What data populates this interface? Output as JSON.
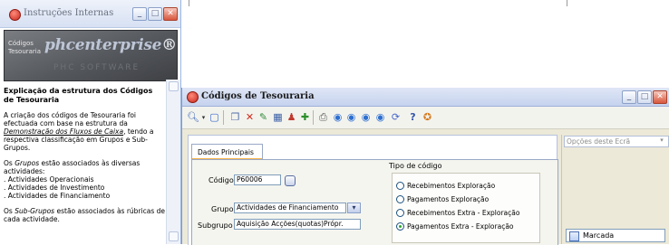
{
  "help_window": {
    "title": "Instruções Internas",
    "banner": {
      "label_line1": "Códigos",
      "label_line2": "Tesouraria",
      "logo_text": "phcenterprise",
      "watermark": "PHC SOFTWARE"
    },
    "content": {
      "heading": "Explicação da estrutura dos Códigos de Tesouraria",
      "p1_before": "A criação dos códigos de Tesouraria foi efectuada com base na estrutura da ",
      "p1_link": "Demonstração dos Fluxos de Caixa",
      "p1_after": ", tendo a respectiva classificação em Grupos e Sub-Grupos.",
      "p2_italic": "Grupos",
      "p2_rest": " estão associados às diversas actividades:",
      "list": [
        ". Actividades Operacionais",
        ". Actividades de Investimento",
        ". Actividades de Financiamento"
      ],
      "p3_before": "Os ",
      "p3_italic": "Sub-Grupos",
      "p3_after": " estão associados às rúbricas de cada actividade.",
      "p2_prefix": "Os "
    }
  },
  "main_window": {
    "title": "Códigos de Tesouraria",
    "tab_label": "Dados Principais",
    "codigo_label": "Código",
    "codigo_value": "P60006",
    "grupo_label": "Grupo",
    "grupo_value": "Actividades de Financiamento",
    "subgrupo_label": "Subgrupo",
    "subgrupo_value": "Aquisição Acções(quotas)Própr.",
    "tipo_label": "Tipo de código",
    "tipo_options": [
      {
        "label": "Recebimentos Exploração",
        "selected": false
      },
      {
        "label": "Pagamentos Exploração",
        "selected": false
      },
      {
        "label": "Recebimentos Extra - Exploração",
        "selected": false
      },
      {
        "label": "Pagamentos Extra - Exploração",
        "selected": true
      }
    ],
    "options_dropdown": "Opções deste Ecrã",
    "marcada_label": "Marcada"
  },
  "colors": {
    "window_bg": "#ece9d8",
    "titlebar": "#c6d3ee",
    "tab_accent": "#f7b247",
    "radio_dot": "#2aa52a"
  }
}
